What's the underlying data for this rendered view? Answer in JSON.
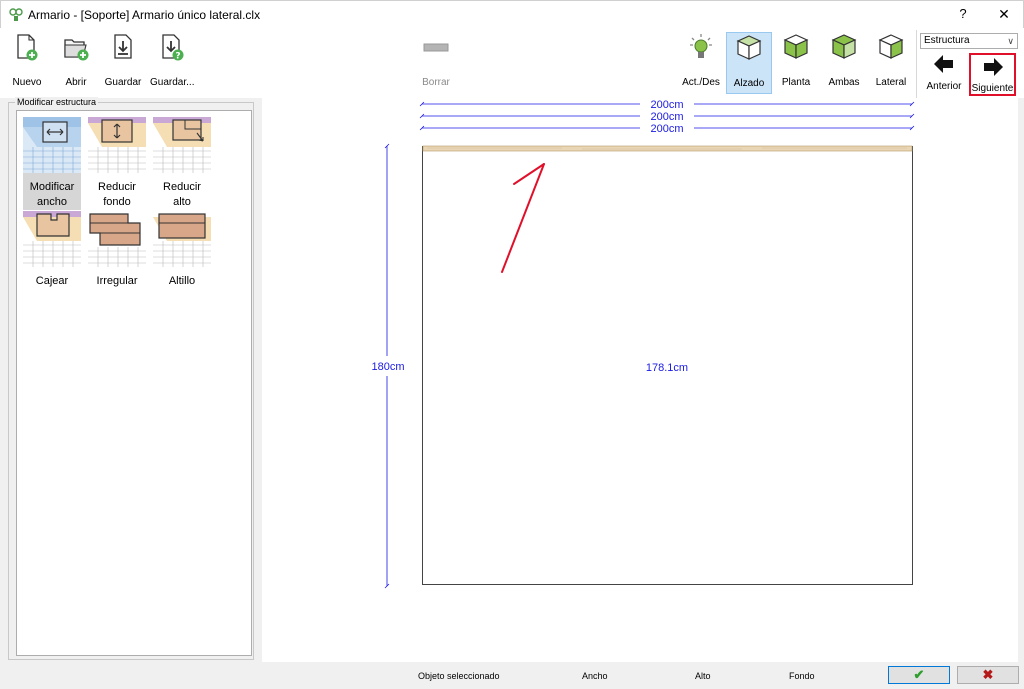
{
  "window": {
    "title": "Armario - [Soporte] Armario único lateral.clx",
    "help": "?",
    "close": "✕"
  },
  "toolbar": {
    "nuevo": "Nuevo",
    "abrir": "Abrir",
    "guardar": "Guardar",
    "guardar_como": "Guardar...",
    "borrar": "Borrar",
    "act_des": "Act./Des",
    "alzado": "Alzado",
    "planta": "Planta",
    "ambas": "Ambas",
    "lateral": "Lateral",
    "anterior": "Anterior",
    "siguiente": "Siguiente",
    "combo_value": "Estructura"
  },
  "panel": {
    "legend": "Modificar estructura",
    "tiles": [
      {
        "label": "Modificar ancho"
      },
      {
        "label": "Reducir fondo"
      },
      {
        "label": "Reducir alto"
      },
      {
        "label": "Cajear"
      },
      {
        "label": "Irregular"
      },
      {
        "label": "Altillo"
      }
    ]
  },
  "drawing": {
    "width_dims": [
      "200cm",
      "200cm",
      "200cm"
    ],
    "height_outer": "180cm",
    "height_inner": "178.1cm",
    "dim_color": "#1a1ae6",
    "annotation_color": "#e0102a"
  },
  "status": {
    "objeto": "Objeto seleccionado",
    "ancho": "Ancho",
    "alto": "Alto",
    "fondo": "Fondo",
    "ok": "✔",
    "cancel": "✖"
  }
}
